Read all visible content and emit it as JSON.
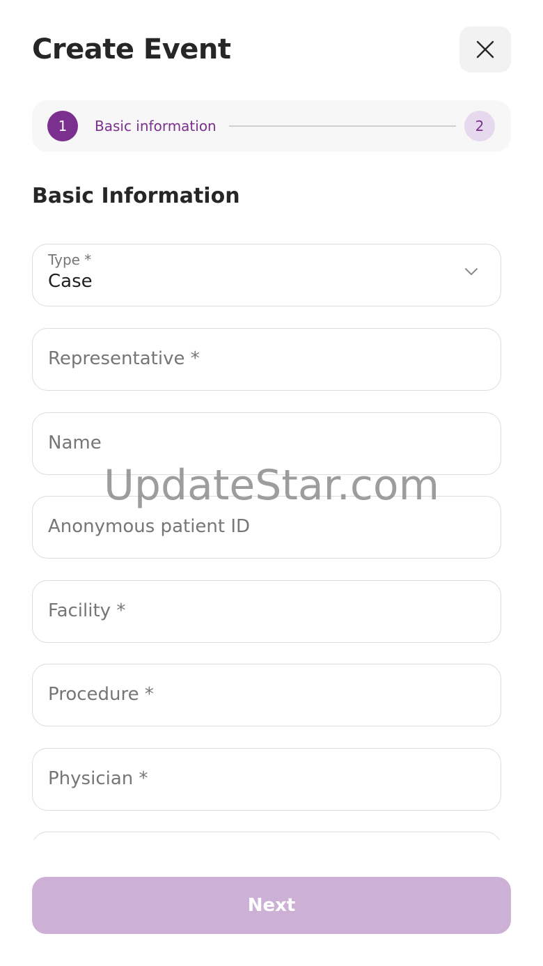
{
  "header": {
    "title": "Create Event",
    "close_icon": "close-icon"
  },
  "stepper": {
    "steps": [
      {
        "number": "1",
        "label": "Basic information",
        "state": "active"
      },
      {
        "number": "2",
        "state": "pending"
      }
    ]
  },
  "section": {
    "title": "Basic Information"
  },
  "fields": [
    {
      "label": "Type *",
      "value": "Case",
      "kind": "select"
    },
    {
      "placeholder": "Representative *"
    },
    {
      "placeholder": "Name"
    },
    {
      "placeholder": "Anonymous patient ID"
    },
    {
      "placeholder": "Facility *"
    },
    {
      "placeholder": "Procedure *"
    },
    {
      "placeholder": "Physician *"
    }
  ],
  "watermark": "UpdateStar.com",
  "footer": {
    "next_label": "Next"
  },
  "colors": {
    "accent": "#7b2f8f",
    "accent_light": "#e6d9ee",
    "button_disabled": "#cdb0d5"
  }
}
